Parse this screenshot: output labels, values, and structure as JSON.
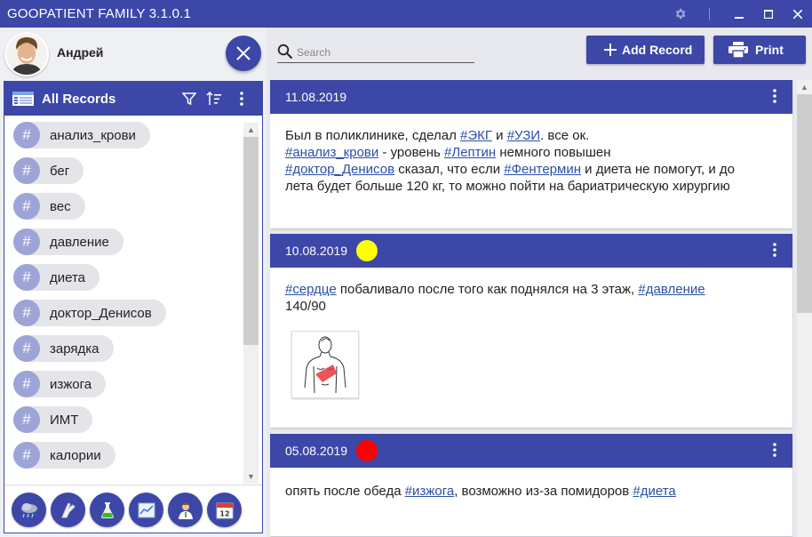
{
  "window": {
    "title": "GOOPATIENT FAMILY 3.1.0.1"
  },
  "profile": {
    "name": "Андрей"
  },
  "records": {
    "title": "All Records"
  },
  "tags": [
    "анализ_крови",
    "бег",
    "вес",
    "давление",
    "диета",
    "доктор_Денисов",
    "зарядка",
    "изжога",
    "ИМТ",
    "калории"
  ],
  "tag_symbol": "#",
  "search": {
    "placeholder": "Search"
  },
  "toolbar": {
    "add_label": "Add Record",
    "print_label": "Print"
  },
  "accent_color": "#3c47a8",
  "feed": [
    {
      "date": "11.08.2019",
      "dot_color": null,
      "lines": [
        [
          {
            "t": "Был в поликлинике, сделал "
          },
          {
            "tag": "#ЭКГ"
          },
          {
            "t": " и "
          },
          {
            "tag": "#УЗИ"
          },
          {
            "t": ". все ок."
          }
        ],
        [
          {
            "tag": "#анализ_крови"
          },
          {
            "t": " - уровень "
          },
          {
            "tag": "#Лептин"
          },
          {
            "t": " немного повышен"
          }
        ],
        [
          {
            "tag": "#доктор_Денисов"
          },
          {
            "t": " сказал, что если "
          },
          {
            "tag": "#Фентермин"
          },
          {
            "t": " и диета не помогут, и до"
          }
        ],
        [
          {
            "t": "лета будет больше 120 кг, то можно пойти на бариатрическую хирургию"
          }
        ]
      ]
    },
    {
      "date": "10.08.2019",
      "dot_color": "#ffff00",
      "lines": [
        [
          {
            "tag": "#сердце"
          },
          {
            "t": " побаливало после того как поднялся на 3 этаж, "
          },
          {
            "tag": "#давление"
          }
        ],
        [
          {
            "t": "140/90"
          }
        ]
      ],
      "has_image": true
    },
    {
      "date": "05.08.2019",
      "dot_color": "#ff0000",
      "lines": [
        [
          {
            "t": "опять после обеда "
          },
          {
            "tag": "#изжога"
          },
          {
            "t": ", возможно из-за помидоров "
          },
          {
            "tag": "#диета"
          }
        ]
      ]
    }
  ]
}
